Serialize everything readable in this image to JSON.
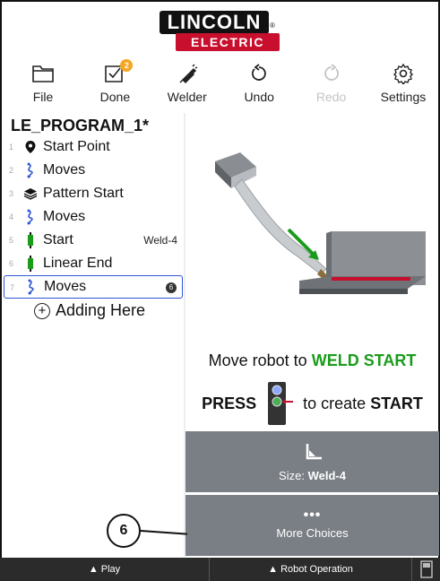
{
  "logo": {
    "line1": "LINCOLN",
    "line2": "ELECTRIC",
    "reg": "®"
  },
  "toolbar": {
    "file": "File",
    "done": "Done",
    "done_badge": "2",
    "welder": "Welder",
    "undo": "Undo",
    "redo": "Redo",
    "settings": "Settings"
  },
  "program": {
    "title": "LE_PROGRAM_1*",
    "steps": [
      {
        "num": "1",
        "icon": "location-pin-icon",
        "label": "Start Point"
      },
      {
        "num": "2",
        "icon": "moves-icon",
        "label": "Moves"
      },
      {
        "num": "3",
        "icon": "layers-icon",
        "label": "Pattern Start"
      },
      {
        "num": "4",
        "icon": "moves-icon",
        "label": "Moves"
      },
      {
        "num": "5",
        "icon": "weld-start-icon",
        "label": "Start",
        "tag": "Weld-4"
      },
      {
        "num": "6",
        "icon": "weld-end-icon",
        "label": "Linear End"
      },
      {
        "num": "7",
        "icon": "moves-icon",
        "label": "Moves",
        "count": "6"
      }
    ],
    "adding": "Adding Here"
  },
  "instructions": {
    "line1_prefix": "Move robot to ",
    "line1_highlight": "WELD START",
    "press": "PRESS",
    "line2_middle": "to create",
    "line2_end": "START"
  },
  "buttons": {
    "size_prefix": "Size: ",
    "size_value": "Weld-4",
    "more": "More Choices",
    "dots": "•••"
  },
  "callout": "6",
  "bottom_bar": {
    "play": "▲ Play",
    "robot": "▲ Robot Operation"
  },
  "colors": {
    "weld_highlight": "#1a9c1a",
    "selection_border": "#2f55d4",
    "button_grey": "#7a7f85",
    "logo_red": "#c8102e",
    "badge_orange": "#f5a623"
  }
}
